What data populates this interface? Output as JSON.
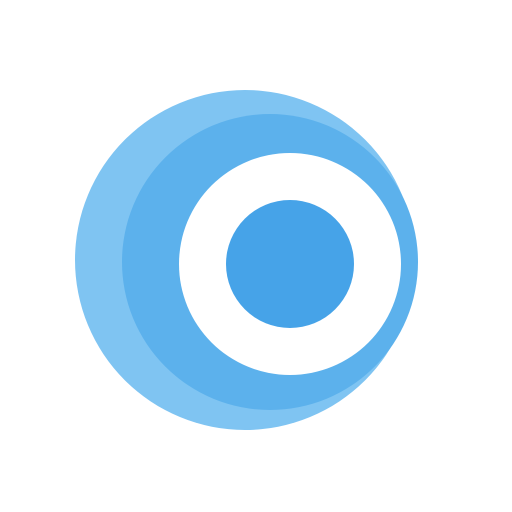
{
  "logo": {
    "icon": "concentric-circles-logo-icon",
    "colors": {
      "background": "#ffffff",
      "outer_ring": "#7fc4f2",
      "middle_ring": "#5cb1ec",
      "inner_ring": "#ffffff",
      "core": "#46a3e8"
    }
  }
}
